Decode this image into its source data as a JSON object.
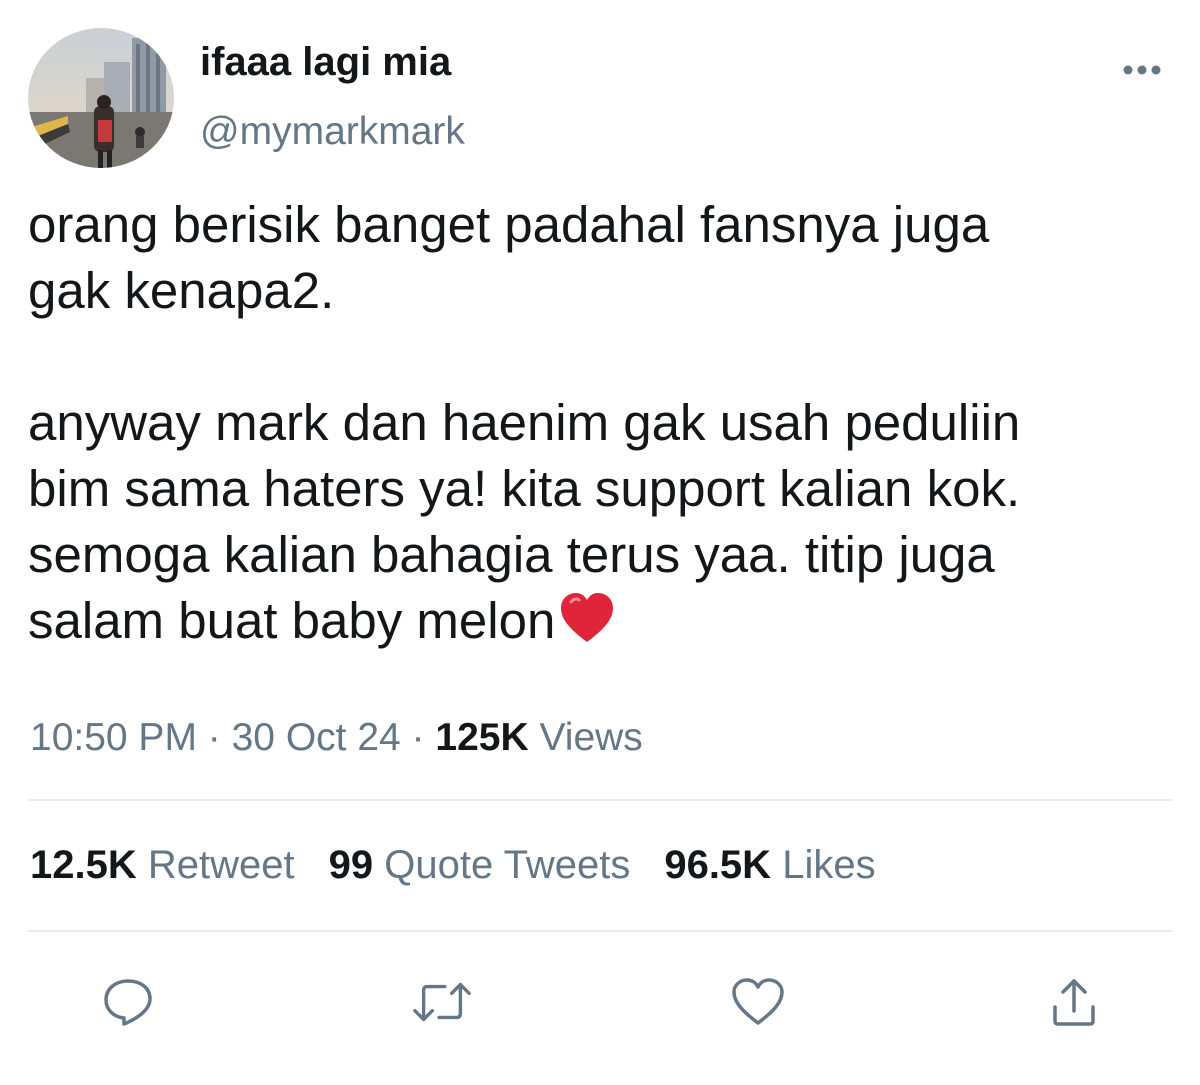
{
  "author": {
    "display_name": "ifaaa lagi mia",
    "handle": "@mymarkmark"
  },
  "tweet": {
    "paragraph_1": "orang berisik banget padahal fansnya juga\ngak kenapa2.",
    "paragraph_2": "anyway mark dan haenim gak usah peduliin\nbim sama haters ya! kita support kalian kok.\nsemoga kalian bahagia terus yaa. titip juga\nsalam buat baby melon",
    "emoji": "red-heart-emoji"
  },
  "meta": {
    "time": "10:50 PM",
    "separator": " · ",
    "date": "30 Oct 24",
    "views_count": "125K",
    "views_label": "Views"
  },
  "stats": {
    "retweets_count": "12.5K",
    "retweets_label": "Retweet",
    "quotes_count": "99",
    "quotes_label": "Quote Tweets",
    "likes_count": "96.5K",
    "likes_label": "Likes"
  },
  "actions": {
    "reply_icon": "comment-icon",
    "retweet_icon": "retweet-icon",
    "like_icon": "heart-icon",
    "share_icon": "share-icon"
  },
  "colors": {
    "text_primary": "#14171a",
    "text_secondary": "#657786",
    "divider": "#e6ecf0",
    "heart_emoji": "#e0243a"
  }
}
